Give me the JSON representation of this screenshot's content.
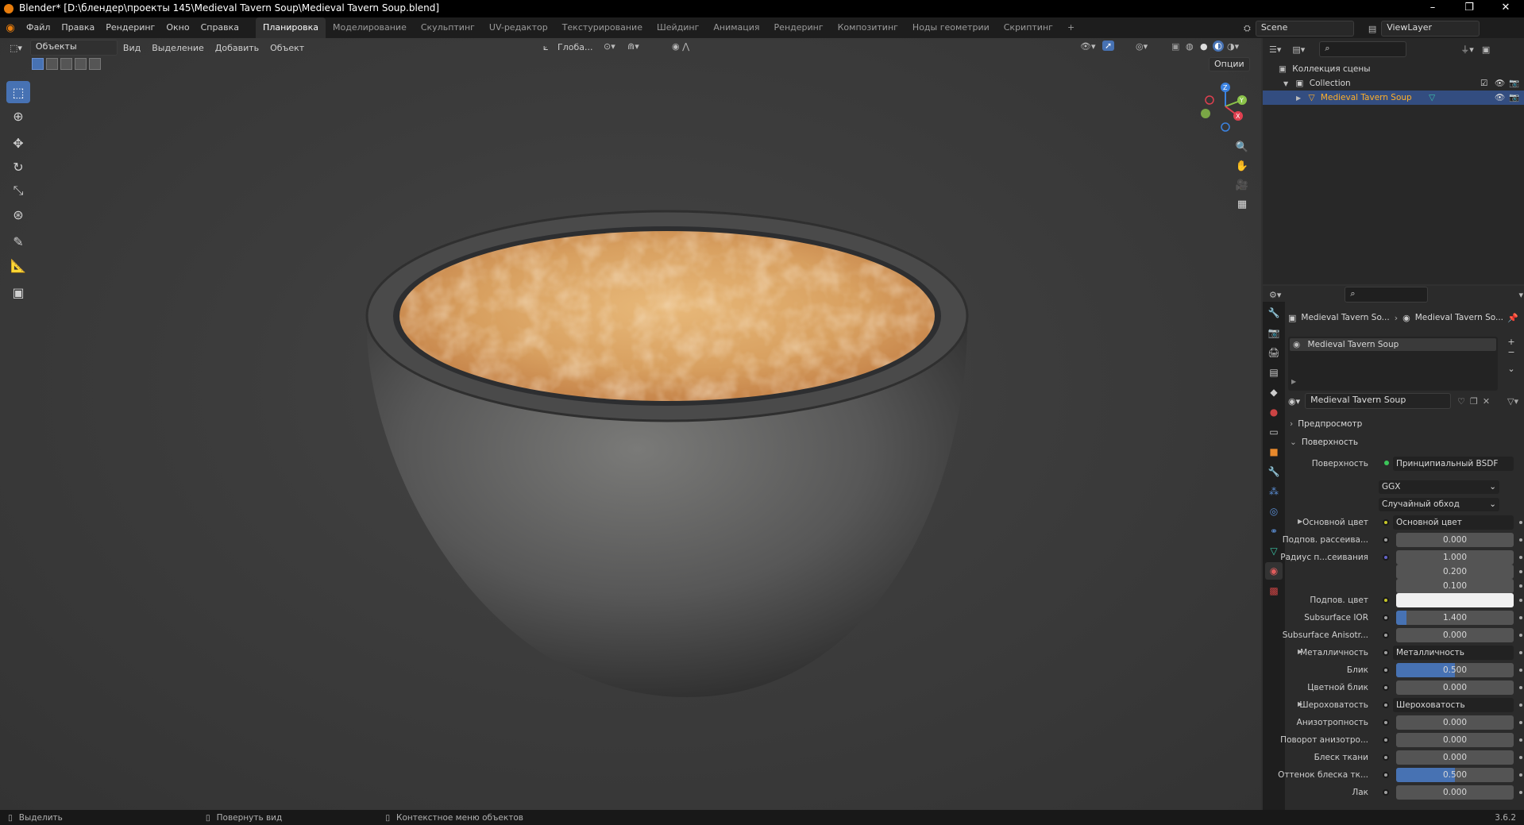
{
  "window": {
    "title": "Blender* [D:\\блендер\\проекты 145\\Medieval Tavern Soup\\Medieval Tavern Soup.blend]",
    "controls": [
      "–",
      "❐",
      "✕"
    ]
  },
  "menu": [
    "Файл",
    "Правка",
    "Рендеринг",
    "Окно",
    "Справка"
  ],
  "workspaces": [
    "Планировка",
    "Моделирование",
    "Скульптинг",
    "UV-редактор",
    "Текстурирование",
    "Шейдинг",
    "Анимация",
    "Рендеринг",
    "Композитинг",
    "Ноды геометрии",
    "Скриптинг",
    "+"
  ],
  "active_workspace": "Планировка",
  "scene": {
    "name": "Scene",
    "view_layer": "ViewLayer"
  },
  "viewport_header": {
    "mode": "Объекты",
    "menus": [
      "Вид",
      "Выделение",
      "Добавить",
      "Объект"
    ],
    "transform_orientation": "Глоба...",
    "options": "Опции"
  },
  "outliner": {
    "scene_collection": "Коллекция сцены",
    "collection": "Collection",
    "object": "Medieval Tavern Soup"
  },
  "properties": {
    "breadcrumb": [
      "Medieval Tavern So...",
      "Medieval Tavern So..."
    ],
    "material_slot": "Medieval Tavern Soup",
    "material_name": "Medieval Tavern Soup",
    "panels": {
      "preview": "Предпросмотр",
      "surface": "Поверхность"
    },
    "surface_label": "Поверхность",
    "surface_value": "Принципиальный BSDF",
    "distribution": "GGX",
    "subsurface_method": "Случайный обход",
    "rows": [
      {
        "label": "Основной цвет",
        "value": "Основной цвет",
        "type": "link",
        "socket": "#c7c729"
      },
      {
        "label": "Подпов. рассеива...",
        "value": "0.000",
        "type": "num",
        "socket": "#a1a1a1"
      },
      {
        "label": "Радиус п...сеивания",
        "value": "1.000",
        "type": "num",
        "socket": "#6363c7"
      },
      {
        "label": "",
        "value": "0.200",
        "type": "num"
      },
      {
        "label": "",
        "value": "0.100",
        "type": "num"
      },
      {
        "label": "Подпов. цвет",
        "value": "",
        "type": "color",
        "socket": "#c7c729"
      },
      {
        "label": "Subsurface IOR",
        "value": "1.400",
        "type": "num",
        "fill": 0.09,
        "socket": "#a1a1a1"
      },
      {
        "label": "Subsurface Anisotr...",
        "value": "0.000",
        "type": "num",
        "socket": "#a1a1a1"
      },
      {
        "label": "Металличность",
        "value": "Металличность",
        "type": "link",
        "socket": "#a1a1a1"
      },
      {
        "label": "Блик",
        "value": "0.500",
        "type": "num",
        "fill": 0.5,
        "socket": "#a1a1a1"
      },
      {
        "label": "Цветной блик",
        "value": "0.000",
        "type": "num",
        "socket": "#a1a1a1"
      },
      {
        "label": "Шероховатость",
        "value": "Шероховатость",
        "type": "link",
        "socket": "#a1a1a1"
      },
      {
        "label": "Анизотропность",
        "value": "0.000",
        "type": "num",
        "socket": "#a1a1a1"
      },
      {
        "label": "Поворот анизотро...",
        "value": "0.000",
        "type": "num",
        "socket": "#a1a1a1"
      },
      {
        "label": "Блеск ткани",
        "value": "0.000",
        "type": "num",
        "socket": "#a1a1a1"
      },
      {
        "label": "Оттенок блеска тк...",
        "value": "0.500",
        "type": "num",
        "fill": 0.5,
        "socket": "#a1a1a1"
      },
      {
        "label": "Лак",
        "value": "0.000",
        "type": "num",
        "socket": "#a1a1a1"
      }
    ]
  },
  "status": {
    "select": "Выделить",
    "rotate": "Повернуть вид",
    "context": "Контекстное меню объектов",
    "version": "3.6.2"
  },
  "colors": {
    "accent": "#4772b3",
    "highlight_text": "#ffaf29",
    "bowl": "#545454",
    "soup": "#d9a062"
  }
}
